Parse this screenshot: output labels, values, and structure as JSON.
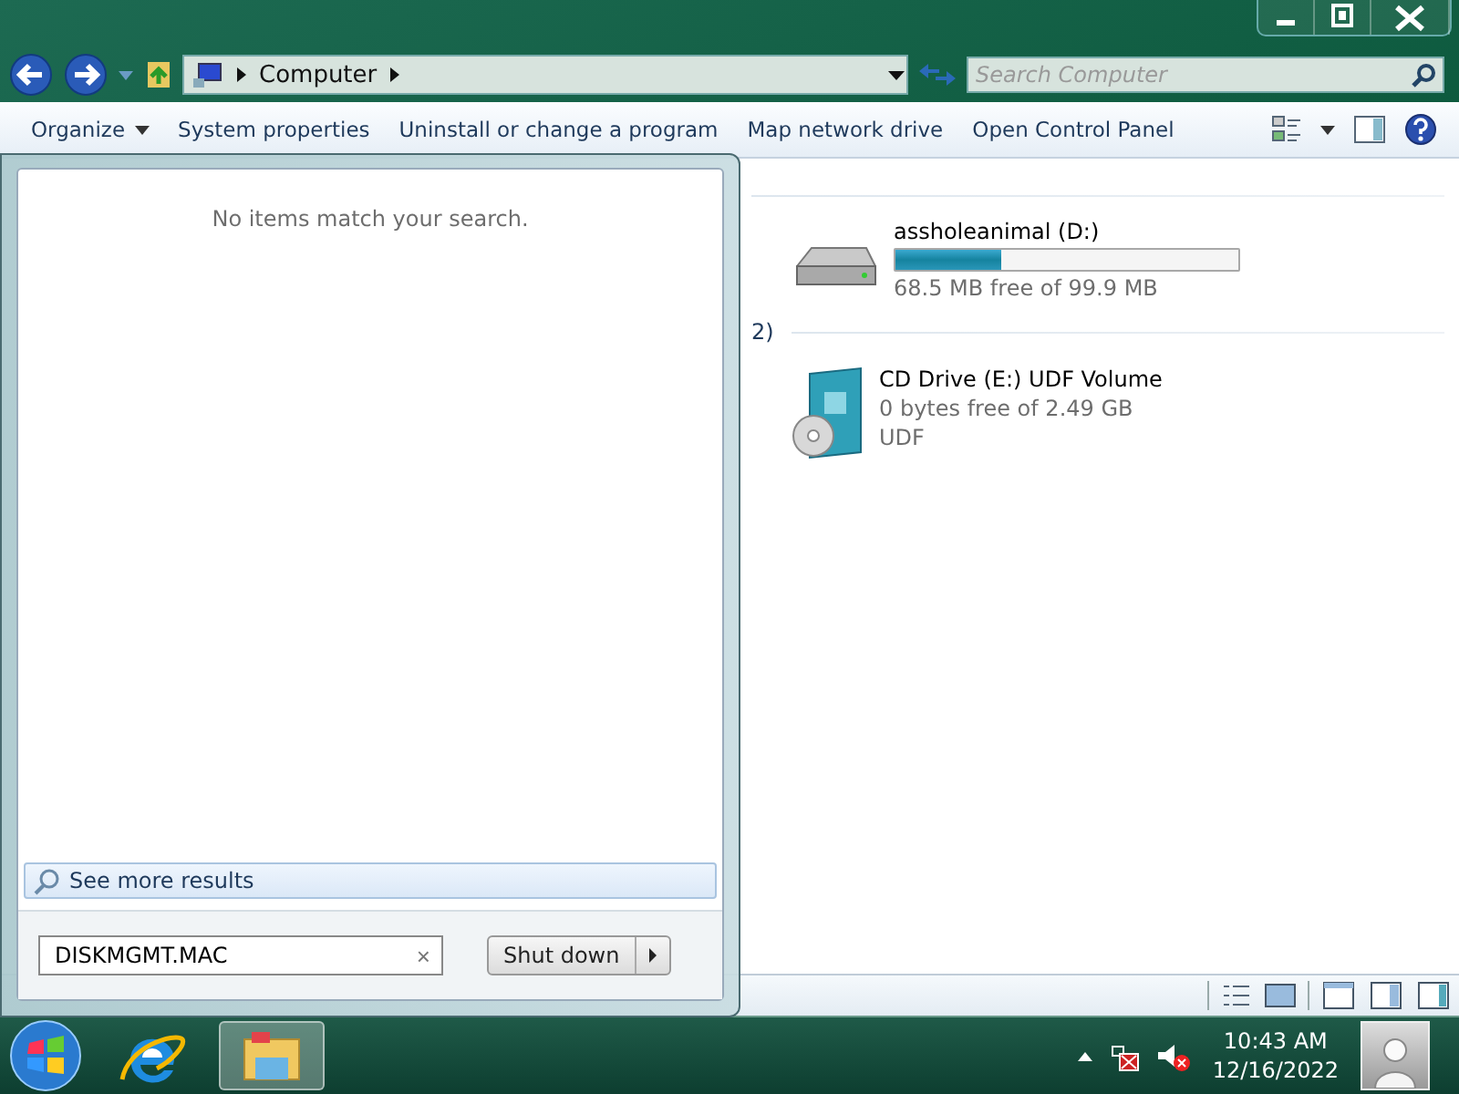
{
  "explorer": {
    "address": {
      "crumbs": [
        "Computer"
      ]
    },
    "search": {
      "placeholder": "Search Computer"
    },
    "toolbar": [
      {
        "label": "Organize",
        "dropdown": true
      },
      {
        "label": "System properties",
        "dropdown": false
      },
      {
        "label": "Uninstall or change a program",
        "dropdown": false
      },
      {
        "label": "Map network drive",
        "dropdown": false
      },
      {
        "label": "Open Control Panel",
        "dropdown": false
      }
    ],
    "group_fragment": "2)",
    "drives": [
      {
        "kind": "disk",
        "name": "assholeanimal (D:)",
        "level": 0.31,
        "free": "68.5 MB free of 99.9 MB"
      },
      {
        "kind": "cd",
        "name": "CD Drive (E:) UDF Volume",
        "free": "0 bytes free of 2.49 GB",
        "filesystem": "UDF"
      }
    ]
  },
  "start_menu": {
    "message": "No items match your search.",
    "see_more": "See more results",
    "search": {
      "value": "DISKMGMT.MAC",
      "clear": "×"
    },
    "shutdown": "Shut down"
  },
  "taskbar": {
    "buttons": [
      {
        "kind": "ie",
        "selected": false
      },
      {
        "kind": "explorer",
        "selected": true
      }
    ],
    "clock": {
      "time": "10:43 AM",
      "date": "12/16/2022"
    }
  }
}
